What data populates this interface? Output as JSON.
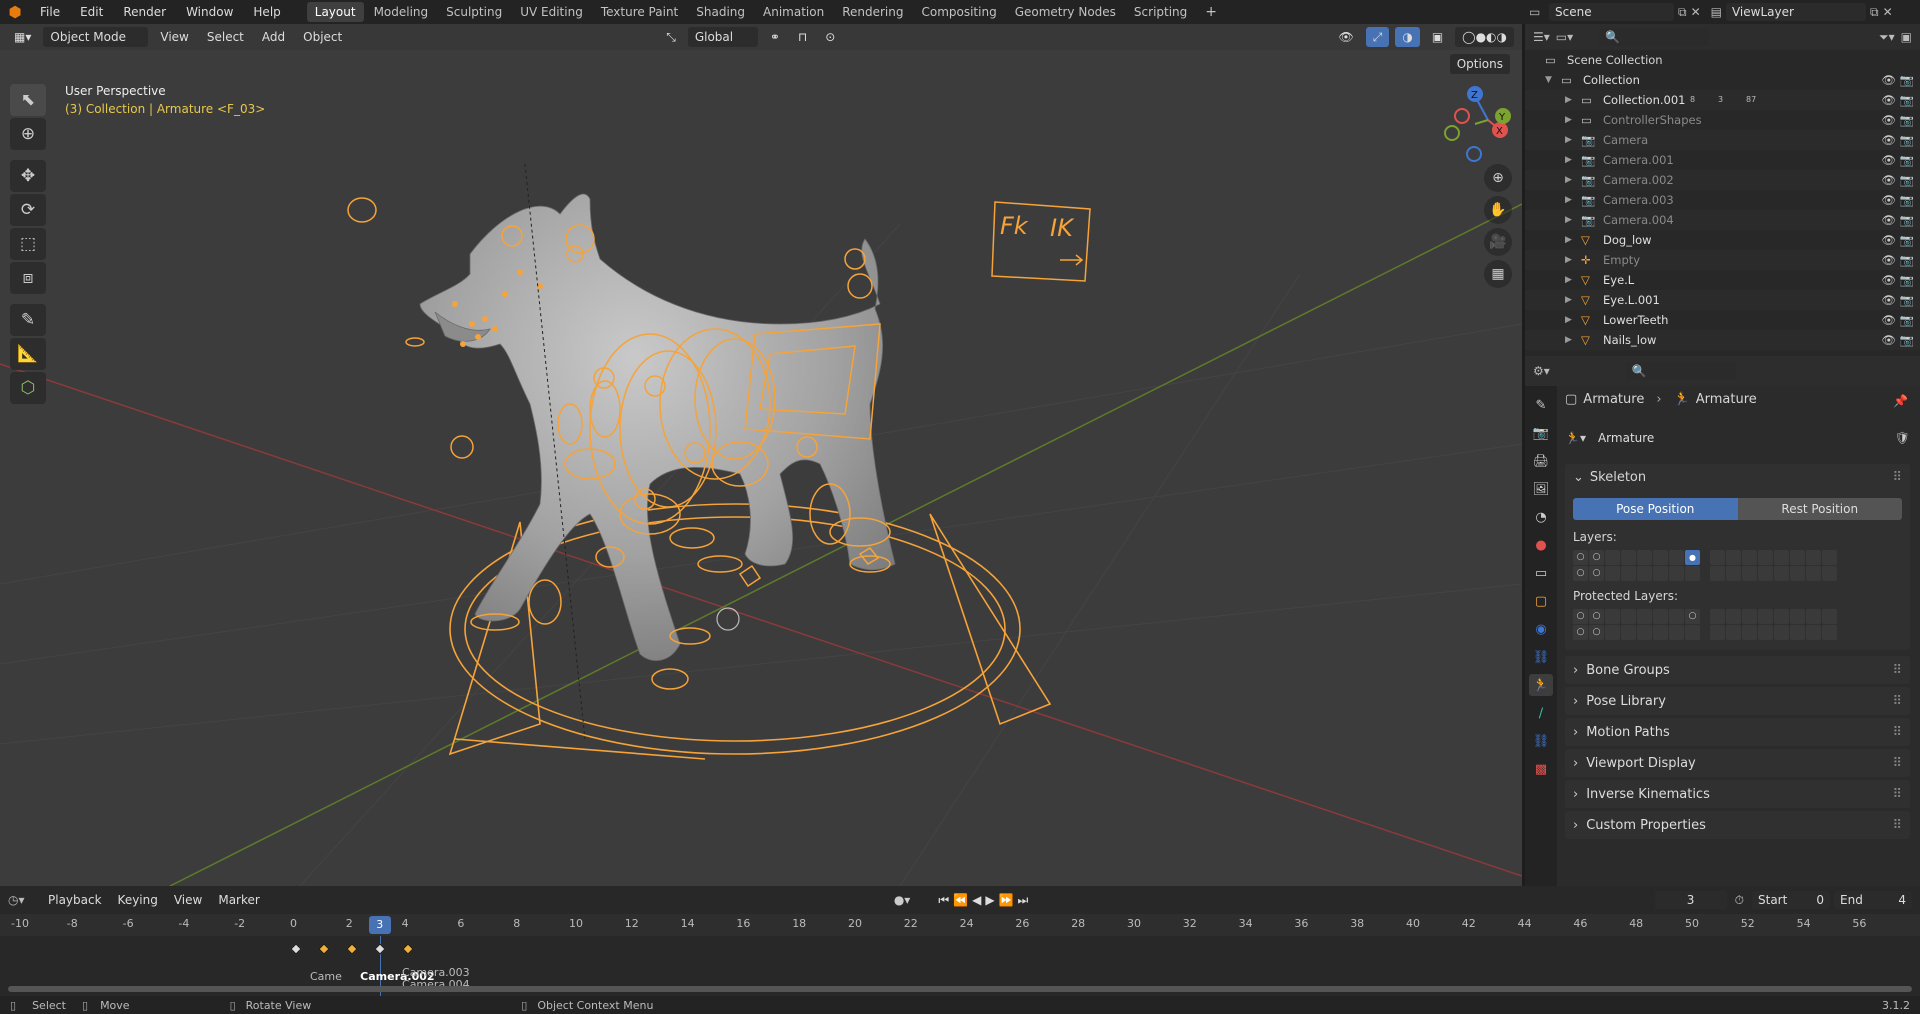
{
  "topbar": {
    "menus": [
      "File",
      "Edit",
      "Render",
      "Window",
      "Help"
    ],
    "workspaces": [
      "Layout",
      "Modeling",
      "Sculpting",
      "UV Editing",
      "Texture Paint",
      "Shading",
      "Animation",
      "Rendering",
      "Compositing",
      "Geometry Nodes",
      "Scripting"
    ],
    "active_workspace": "Layout",
    "add_tab": "+"
  },
  "scenebar": {
    "scene": "Scene",
    "viewlayer": "ViewLayer"
  },
  "viewport": {
    "mode": "Object Mode",
    "menus": [
      "View",
      "Select",
      "Add",
      "Object"
    ],
    "orientation": "Global",
    "options": "Options",
    "perspective": "User Perspective",
    "context": "(3) Collection | Armature <F_03>",
    "ctrl_label_fk": "Fk",
    "ctrl_label_ik": "IK",
    "gizmo": {
      "x": "X",
      "y": "Y",
      "z": "Z"
    }
  },
  "outliner": {
    "root": "Scene Collection",
    "rows": [
      {
        "name": "Collection",
        "indent": 1,
        "kind": "collection",
        "expanded": true
      },
      {
        "name": "Collection.001",
        "indent": 2,
        "kind": "collection",
        "badges": [
          "8",
          "3",
          "87"
        ]
      },
      {
        "name": "ControllerShapes",
        "indent": 2,
        "kind": "collection",
        "dim": true
      },
      {
        "name": "Camera",
        "indent": 2,
        "kind": "camera",
        "dim": true
      },
      {
        "name": "Camera.001",
        "indent": 2,
        "kind": "camera",
        "dim": true
      },
      {
        "name": "Camera.002",
        "indent": 2,
        "kind": "camera",
        "dim": true
      },
      {
        "name": "Camera.003",
        "indent": 2,
        "kind": "camera",
        "dim": true
      },
      {
        "name": "Camera.004",
        "indent": 2,
        "kind": "camera",
        "dim": true
      },
      {
        "name": "Dog_low",
        "indent": 2,
        "kind": "mesh"
      },
      {
        "name": "Empty",
        "indent": 2,
        "kind": "empty",
        "dim": true
      },
      {
        "name": "Eye.L",
        "indent": 2,
        "kind": "mesh"
      },
      {
        "name": "Eye.L.001",
        "indent": 2,
        "kind": "mesh"
      },
      {
        "name": "LowerTeeth",
        "indent": 2,
        "kind": "mesh"
      },
      {
        "name": "Nails_low",
        "indent": 2,
        "kind": "mesh"
      }
    ]
  },
  "properties": {
    "breadcrumb_a": "Armature",
    "breadcrumb_sep": "›",
    "breadcrumb_b": "Armature",
    "data_name": "Armature",
    "skeleton": "Skeleton",
    "pose_position": "Pose Position",
    "rest_position": "Rest Position",
    "layers": "Layers:",
    "protected_layers": "Protected Layers:",
    "panels": [
      "Bone Groups",
      "Pose Library",
      "Motion Paths",
      "Viewport Display",
      "Inverse Kinematics",
      "Custom Properties"
    ]
  },
  "timeline": {
    "menus": [
      "Playback",
      "Keying",
      "View",
      "Marker"
    ],
    "current_frame": "3",
    "start_label": "Start",
    "start": "0",
    "end_label": "End",
    "end": "4",
    "ticks": [
      "-10",
      "-8",
      "-6",
      "-4",
      "-2",
      "0",
      "2",
      "4",
      "6",
      "8",
      "10",
      "12",
      "14",
      "16",
      "18",
      "20",
      "22",
      "24",
      "26",
      "28",
      "30",
      "32",
      "34",
      "36",
      "38",
      "40",
      "42",
      "44",
      "46",
      "48",
      "50",
      "52",
      "54",
      "56"
    ],
    "marker_a": "Camera.003",
    "marker_b": "Camera.004",
    "marker_active": "Camera.002",
    "marker_overlap": "Came"
  },
  "statusbar": {
    "select": "Select",
    "move": "Move",
    "rotate": "Rotate View",
    "context_menu": "Object Context Menu",
    "version": "3.1.2"
  },
  "colors": {
    "accent": "#4772b3",
    "bone": "#f5a33a",
    "mesh": "#a3a3a3",
    "x_axis": "#e0524e",
    "y_axis": "#7ca22f",
    "z_axis": "#3f76d3"
  }
}
